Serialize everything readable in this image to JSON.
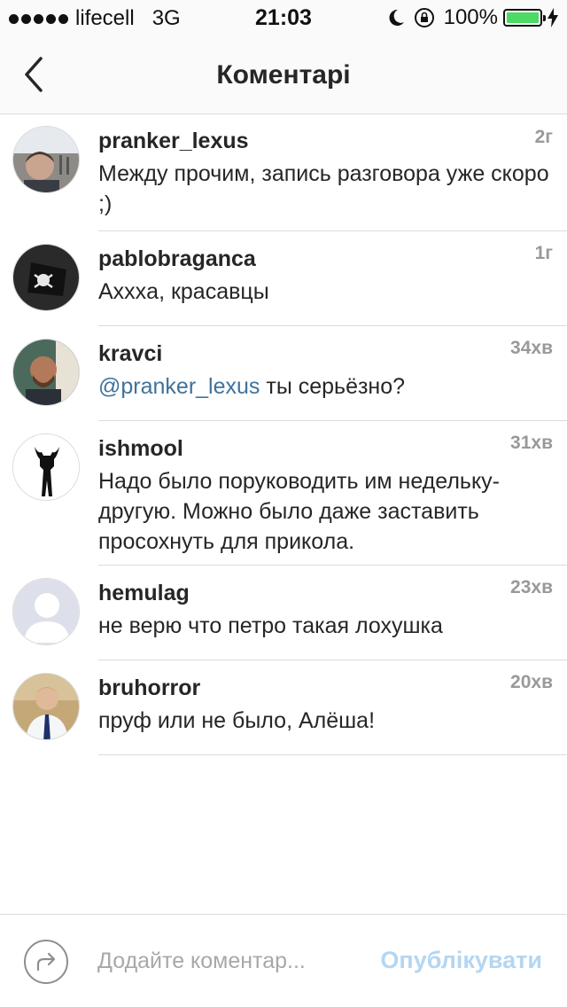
{
  "status_bar": {
    "carrier": "lifecell",
    "network": "3G",
    "time": "21:03",
    "battery_percent": "100%",
    "battery_level": 1.0,
    "icons": [
      "signal-dots-icon",
      "do-not-disturb-moon-icon",
      "rotation-lock-icon",
      "battery-icon",
      "charging-bolt-icon"
    ]
  },
  "header": {
    "title": "Коментарі",
    "back_icon": "chevron-left-icon"
  },
  "comments": [
    {
      "username": "pranker_lexus",
      "time": "2г",
      "text": "Между прочим, запись разговора уже скоро ;)"
    },
    {
      "username": "pablobraganca",
      "time": "1г",
      "text": "Ахххa, красавцы"
    },
    {
      "username": "kravci",
      "time": "34хв",
      "mention": "@pranker_lexus",
      "text": " ты серьёзно?"
    },
    {
      "username": "ishmool",
      "time": "31хв",
      "text": "Надо было поруководить им недельку-другую. Можно было даже заставить просохнуть для прикола."
    },
    {
      "username": "hemulag",
      "time": "23хв",
      "text": "не верю что петро такая лохушка"
    },
    {
      "username": "bruhorror",
      "time": "20хв",
      "text": "пруф или не было, Алёша!"
    }
  ],
  "input_bar": {
    "placeholder": "Додайте коментар...",
    "publish_label": "Опублікувати",
    "share_icon": "share-arrow-icon"
  },
  "colors": {
    "mention": "#3f729b",
    "publish_disabled": "#b3d6f2",
    "battery": "#4cd964"
  }
}
